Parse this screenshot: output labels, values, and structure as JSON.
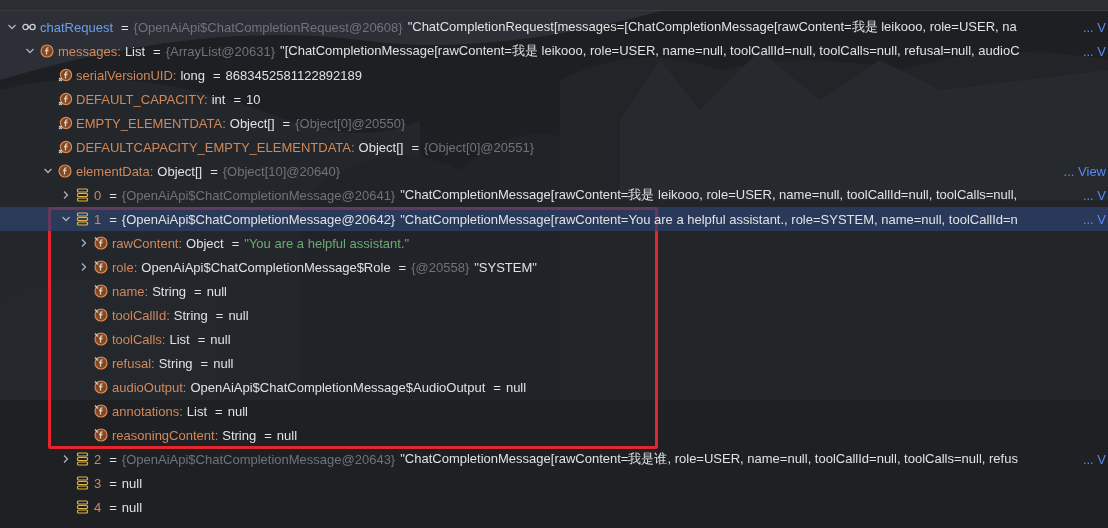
{
  "tree": [
    {
      "kind": "watch",
      "name": "chatRequest",
      "equals": "=",
      "ref": "{OpenAiApi$ChatCompletionRequest@20608}",
      "value": "\"ChatCompletionRequest[messages=[ChatCompletionMessage[rawContent=我是 leikooo, role=USER, na",
      "link": "... V",
      "expanded": true,
      "selected": false,
      "children": [
        {
          "kind": "field",
          "name": "messages:",
          "type": "List",
          "equals": "=",
          "ref": "{ArrayList@20631}",
          "value": "\"[ChatCompletionMessage[rawContent=我是 leikooo, role=USER, name=null, toolCallId=null, toolCalls=null, refusal=null, audioC",
          "link": "... V",
          "expanded": true,
          "selected": false,
          "children": [
            {
              "kind": "static-field",
              "name": "serialVersionUID:",
              "type": "long",
              "equals": "=",
              "value": "8683452581122892189",
              "selected": false
            },
            {
              "kind": "static-field",
              "name": "DEFAULT_CAPACITY:",
              "type": "int",
              "equals": "=",
              "value": "10",
              "selected": false
            },
            {
              "kind": "static-field",
              "name": "EMPTY_ELEMENTDATA:",
              "type": "Object[]",
              "equals": "=",
              "ref": "{Object[0]@20550}",
              "selected": false
            },
            {
              "kind": "static-field",
              "name": "DEFAULTCAPACITY_EMPTY_ELEMENTDATA:",
              "type": "Object[]",
              "equals": "=",
              "ref": "{Object[0]@20551}",
              "selected": false
            },
            {
              "kind": "field",
              "name": "elementData:",
              "type": "Object[]",
              "equals": "=",
              "ref": "{Object[10]@20640}",
              "link": "... View",
              "expanded": true,
              "selected": false,
              "children": [
                {
                  "kind": "array-element",
                  "name": "0",
                  "equals": "=",
                  "ref": "{OpenAiApi$ChatCompletionMessage@20641}",
                  "value": "\"ChatCompletionMessage[rawContent=我是 leikooo, role=USER, name=null, toolCallId=null, toolCalls=null,",
                  "link": "... V",
                  "expanded": false,
                  "selected": false
                },
                {
                  "kind": "array-element",
                  "name": "1",
                  "equals": "=",
                  "ref": "{OpenAiApi$ChatCompletionMessage@20642}",
                  "value": "\"ChatCompletionMessage[rawContent=You are a helpful assistant., role=SYSTEM, name=null, toolCallId=n",
                  "link": "... V",
                  "expanded": true,
                  "selected": true,
                  "highlighted": true,
                  "children": [
                    {
                      "kind": "final-field",
                      "name": "rawContent:",
                      "type": "Object",
                      "equals": "=",
                      "string_value": "\"You are a helpful assistant.\"",
                      "expanded": false,
                      "selected": false
                    },
                    {
                      "kind": "final-field",
                      "name": "role:",
                      "type": "OpenAiApi$ChatCompletionMessage$Role",
                      "equals": "=",
                      "ref": "{@20558}",
                      "value": "\"SYSTEM\"",
                      "expanded": false,
                      "selected": false
                    },
                    {
                      "kind": "final-field",
                      "name": "name:",
                      "type": "String",
                      "equals": "=",
                      "value": "null",
                      "selected": false
                    },
                    {
                      "kind": "final-field",
                      "name": "toolCallId:",
                      "type": "String",
                      "equals": "=",
                      "value": "null",
                      "selected": false
                    },
                    {
                      "kind": "final-field",
                      "name": "toolCalls:",
                      "type": "List",
                      "equals": "=",
                      "value": "null",
                      "selected": false
                    },
                    {
                      "kind": "final-field",
                      "name": "refusal:",
                      "type": "String",
                      "equals": "=",
                      "value": "null",
                      "selected": false
                    },
                    {
                      "kind": "final-field",
                      "name": "audioOutput:",
                      "type": "OpenAiApi$ChatCompletionMessage$AudioOutput",
                      "equals": "=",
                      "value": "null",
                      "selected": false
                    },
                    {
                      "kind": "final-field",
                      "name": "annotations:",
                      "type": "List",
                      "equals": "=",
                      "value": "null",
                      "selected": false
                    },
                    {
                      "kind": "final-field",
                      "name": "reasoningContent:",
                      "type": "String",
                      "equals": "=",
                      "value": "null",
                      "selected": false
                    }
                  ]
                },
                {
                  "kind": "array-element",
                  "name": "2",
                  "equals": "=",
                  "ref": "{OpenAiApi$ChatCompletionMessage@20643}",
                  "value": "\"ChatCompletionMessage[rawContent=我是谁, role=USER, name=null, toolCallId=null, toolCalls=null, refus",
                  "link": "... V",
                  "expanded": false,
                  "selected": false
                },
                {
                  "kind": "array-element",
                  "name": "3",
                  "equals": "=",
                  "value": "null",
                  "selected": false
                },
                {
                  "kind": "array-element",
                  "name": "4",
                  "equals": "=",
                  "value": "null",
                  "selected": false
                }
              ]
            }
          ]
        }
      ]
    }
  ]
}
